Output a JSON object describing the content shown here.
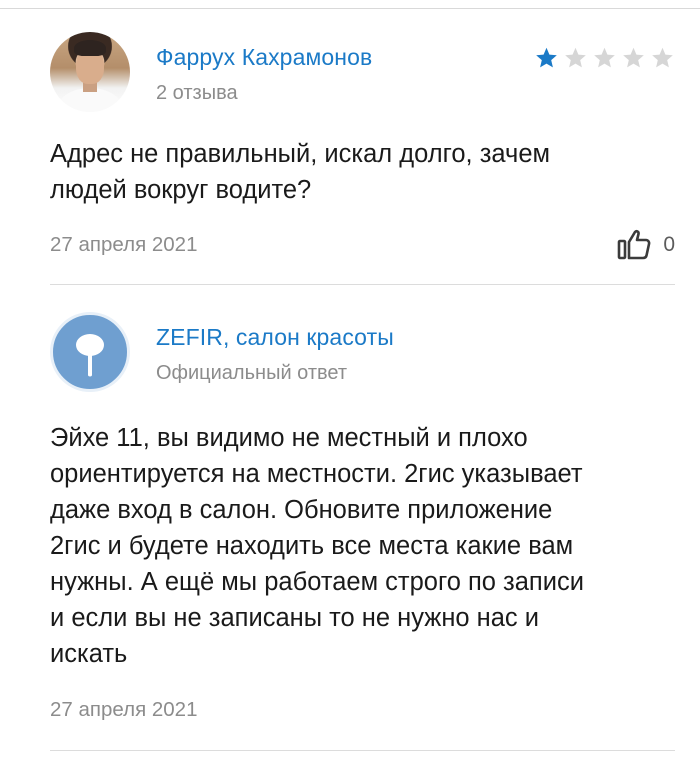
{
  "review": {
    "author": "Фаррух Кахрамонов",
    "review_count": "2 отзыва",
    "rating": 1,
    "rating_max": 5,
    "text": "Адрес не правильный, искал долго, зачем\nлюдей вокруг водите?",
    "date": "27 апреля 2021",
    "likes": "0",
    "icons": {
      "avatar": "user-avatar",
      "star_filled": "star-filled-icon",
      "star_empty": "star-empty-icon",
      "like": "thumbs-up-icon"
    }
  },
  "reply": {
    "author": "ZEFIR, салон красоты",
    "label": "Официальный ответ",
    "text": "Эйхе 11, вы видимо не местный и плохо\nориентируется на местности. 2гис указывает\nдаже вход в салон. Обновите приложение\n2гис и будете находить все места какие вам\nнужны. А ещё мы работаем строго по записи\nи если вы не записаны то не нужно нас и\nискать",
    "date": "27 апреля 2021",
    "icons": {
      "avatar": "organization-avatar"
    }
  },
  "colors": {
    "link": "#1b7ac7",
    "star_filled": "#1b7ac7",
    "star_empty": "#d6d6d6",
    "muted_text": "#8c8c8c",
    "org_avatar": "#6f9fd0"
  }
}
